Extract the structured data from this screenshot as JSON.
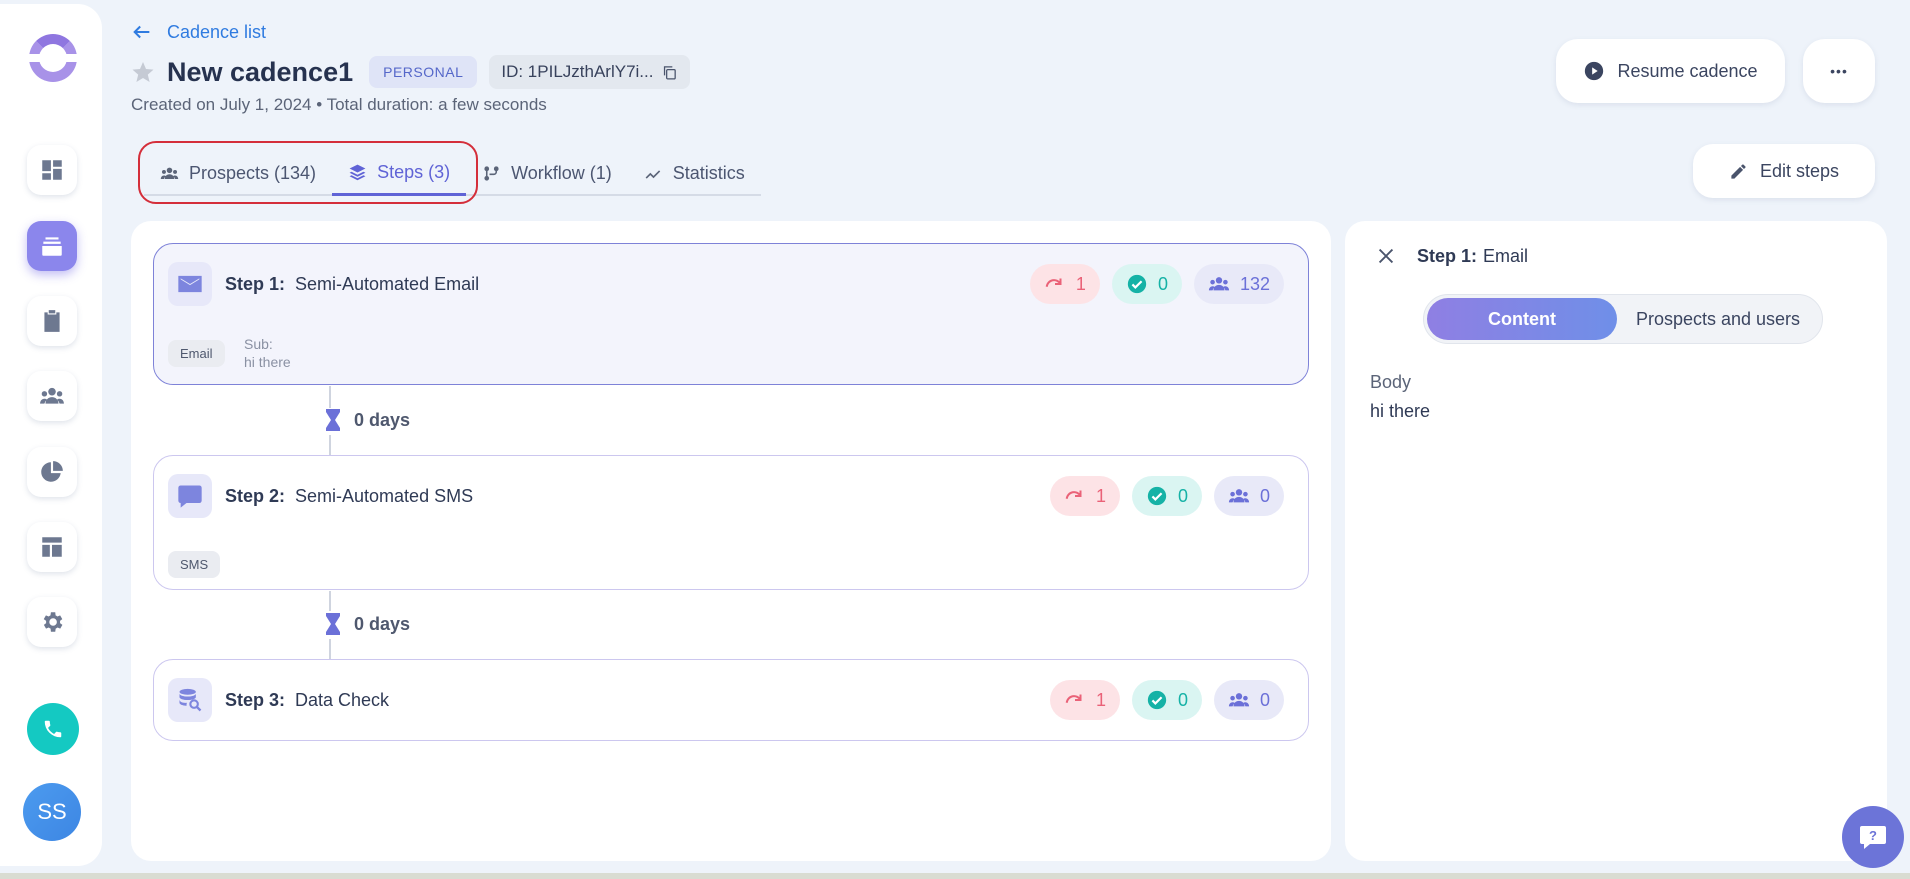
{
  "nav": {
    "avatar_initials": "SS",
    "items": [
      "dashboard-icon",
      "cadences-icon",
      "tasks-icon",
      "prospects-icon",
      "reports-icon",
      "templates-icon",
      "settings-icon"
    ]
  },
  "header": {
    "back_label": "Cadence list",
    "title": "New cadence1",
    "badge": "PERSONAL",
    "id_label": "ID: 1PILJzthArlY7i...",
    "subtitle": "Created on July 1, 2024 • Total duration: a few seconds",
    "resume_label": "Resume cadence",
    "more_label": "•••",
    "edit_steps_label": "Edit steps"
  },
  "tabs": [
    {
      "label": "Prospects (134)",
      "active": false
    },
    {
      "label": "Steps (3)",
      "active": true
    },
    {
      "label": "Workflow (1)",
      "active": false
    },
    {
      "label": "Statistics",
      "active": false
    }
  ],
  "steps": [
    {
      "number": "Step 1:",
      "name": "Semi-Automated Email",
      "bounced": "1",
      "completed": "0",
      "prospects": "132",
      "channel": "Email",
      "sub_label": "Sub:",
      "sub_value": "hi there"
    },
    {
      "number": "Step 2:",
      "name": "Semi-Automated SMS",
      "bounced": "1",
      "completed": "0",
      "prospects": "0",
      "channel": "SMS"
    },
    {
      "number": "Step 3:",
      "name": "Data Check",
      "bounced": "1",
      "completed": "0",
      "prospects": "0"
    }
  ],
  "delays": [
    "0 days",
    "0 days"
  ],
  "side_panel": {
    "step_number": "Step 1:",
    "step_type": "Email",
    "toggle_on": "Content",
    "toggle_off": "Prospects and users",
    "body_label": "Body",
    "body_value": "hi there"
  },
  "colors": {
    "accent": "#5f63d6",
    "teal": "#14c9c2",
    "danger": "#ea6278",
    "highlight": "#d42e3a"
  }
}
